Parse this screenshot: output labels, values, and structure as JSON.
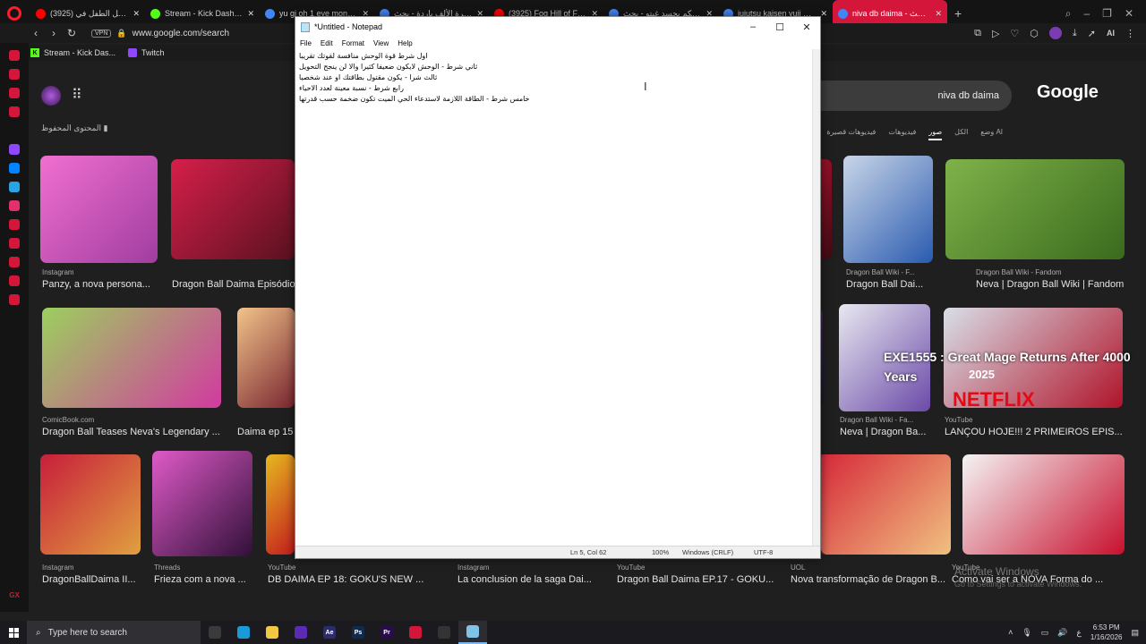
{
  "browser": {
    "tabs": [
      {
        "label": "(3925) جريت الأكل الطفل في",
        "icon": "youtube-icon",
        "color": "#ff0000"
      },
      {
        "label": "Stream - Kick Dashboard",
        "icon": "kick-icon",
        "color": "#53fc18"
      },
      {
        "label": "yu gi oh 1 eye monster w...",
        "icon": "google-icon",
        "color": "#4285f4"
      },
      {
        "label": "نظرة الألف باردة - بحث Google",
        "icon": "google-icon",
        "color": "#4285f4"
      },
      {
        "label": "(3925) Fog Hill of Five Ele...",
        "icon": "youtube-icon",
        "color": "#ff0000"
      },
      {
        "label": "من يتحكم بجسد غيتو - بحث",
        "icon": "google-icon",
        "color": "#4285f4"
      },
      {
        "label": "jujutsu kaisen yuji mother",
        "icon": "google-icon",
        "color": "#4285f4"
      },
      {
        "label": "niva db daima - بحث Google",
        "icon": "google-icon",
        "color": "#4285f4",
        "active": true
      }
    ],
    "url": "www.google.com/search",
    "vpn_label": "VPN",
    "ai_label": "AI",
    "bookmarks": [
      {
        "label": "Stream - Kick Das...",
        "icon": "kick-icon"
      },
      {
        "label": "Twitch",
        "icon": "twitch-icon"
      }
    ],
    "sidebar_colors": [
      "#d4163a",
      "#d4163a",
      "#d4163a",
      "#d4163a",
      "#9146ff",
      "#0084ff",
      "#2aa3e3",
      "#e1306c",
      "#d4163a",
      "#d4163a",
      "#d4163a",
      "#d4163a",
      "#d4163a"
    ],
    "sidebar_footer": "GX"
  },
  "google": {
    "query": "niva db daima",
    "logo": "Google",
    "saved_label": "المحتوى المحفوظ",
    "tabs": [
      "وضع AI",
      "الكل",
      "صور",
      "فيديوهات",
      "فيديوهات قصيرة"
    ],
    "images": [
      {
        "caption": "Panzy, a nova persona...",
        "source": "Instagram",
        "colors": [
          "#f06fd0",
          "#a03ea0"
        ]
      },
      {
        "caption": "Dragon Ball Daima Episódio",
        "source": "",
        "colors": [
          "#d61f4a",
          "#5a1120"
        ]
      },
      {
        "caption": "m",
        "source": "",
        "colors": [
          "#b3122e",
          "#400a14"
        ]
      },
      {
        "caption": "Dragon Ball Dai...",
        "source": "Dragon Ball Wiki - F...",
        "colors": [
          "#c9d6e8",
          "#2a5bb0"
        ]
      },
      {
        "caption": "Neva | Dragon Ball Wiki | Fandom",
        "source": "Dragon Ball Wiki - Fandom",
        "colors": [
          "#7fb24a",
          "#3a6a1d"
        ]
      },
      {
        "caption": "Dragon Ball Teases Neva's Legendary ...",
        "source": "ComicBook.com",
        "colors": [
          "#9ccf5e",
          "#d23aa0"
        ]
      },
      {
        "caption": "Daima ep 15",
        "source": "",
        "colors": [
          "#f1c48a",
          "#7a2630"
        ]
      },
      {
        "caption": "",
        "source": "",
        "colors": [
          "#4a2f6a",
          "#1a1030"
        ]
      },
      {
        "caption": "Neva | Dragon Ba...",
        "source": "Dragon Ball Wiki - Fa...",
        "colors": [
          "#e8e8f0",
          "#6b4aa8"
        ]
      },
      {
        "caption": "LANÇOU HOJE!!! 2 PRIMEIROS EPIS...",
        "source": "YouTube",
        "colors": [
          "#d8dfe8",
          "#b0142a"
        ]
      },
      {
        "caption": "DragonBallDaima II...",
        "source": "Instagram",
        "colors": [
          "#c81e3a",
          "#e0a040"
        ]
      },
      {
        "caption": "Frieza com a nova ...",
        "source": "Threads",
        "colors": [
          "#e05ac8",
          "#301038"
        ]
      },
      {
        "caption": "DB DAIMA EP 18: GOKU'S NEW ...",
        "source": "YouTube",
        "colors": [
          "#e6b820",
          "#c41e1e"
        ]
      },
      {
        "caption": "La conclusion de la saga Dai...",
        "source": "Instagram",
        "colors": [
          "#e03050",
          "#501020"
        ]
      },
      {
        "caption": "Dragon Ball Daima EP.17 - GOKU...",
        "source": "YouTube",
        "colors": [
          "#e03a4a",
          "#701524"
        ]
      },
      {
        "caption": "Nova transformação de Dragon B...",
        "source": "UOL",
        "colors": [
          "#d62a3a",
          "#f0c080"
        ]
      },
      {
        "caption": "Como vai ser a NOVA Forma do ...",
        "source": "YouTube",
        "colors": [
          "#f4f4f4",
          "#c8102e"
        ]
      }
    ],
    "overlay": {
      "line1": "EXE1555 : Great Mage Returns After 4000",
      "line2": "Years"
    },
    "netflix_text": "NETFLIX",
    "year_text": "2025",
    "windows_activation": {
      "title": "Activate Windows",
      "subtitle": "Go to Settings to activate Windows."
    }
  },
  "notepad": {
    "title": "*Untitled - Notepad",
    "menu": [
      "File",
      "Edit",
      "Format",
      "View",
      "Help"
    ],
    "lines": [
      "اول شرط قوة الوحش منافسة لقوتك تقريبا",
      "ثاني شرط - الوحش لايكون ضعيفا كثيرا والا لن ينجح التحويل",
      "ثالث شرا - يكون مقتول بطاقتك او عند شخصيا",
      "رابع شرط - نسبة معينة لعدد الاحياء",
      "خامس شرط - الطاقة اللازمة لاستدعاء الحي الميت تكون ضخمة حسب قدرتها"
    ],
    "status": {
      "position": "Ln 5, Col 62",
      "zoom": "100%",
      "line_endings": "Windows (CRLF)",
      "encoding": "UTF-8"
    }
  },
  "taskbar": {
    "search_placeholder": "Type here to search",
    "apps": [
      {
        "name": "task-view",
        "color": "#3a3a3a",
        "label": ""
      },
      {
        "name": "edge",
        "color": "#1a9bd8",
        "label": ""
      },
      {
        "name": "file-explorer",
        "color": "#f2c744",
        "label": ""
      },
      {
        "name": "premiere-rush",
        "color": "#5b2bb5",
        "label": ""
      },
      {
        "name": "after-effects",
        "color": "#2b2b6e",
        "label": "Ae"
      },
      {
        "name": "photoshop",
        "color": "#0f2a4d",
        "label": "Ps"
      },
      {
        "name": "premiere-pro",
        "color": "#2a0c4e",
        "label": "Pr"
      },
      {
        "name": "opera-gx",
        "color": "#d4163a",
        "label": ""
      },
      {
        "name": "obs",
        "color": "#333333",
        "label": ""
      },
      {
        "name": "notepad",
        "color": "#7fc4e8",
        "label": "",
        "active": true
      }
    ],
    "time": "6:53 PM",
    "date": "1/16/2026",
    "lang": "ع"
  }
}
